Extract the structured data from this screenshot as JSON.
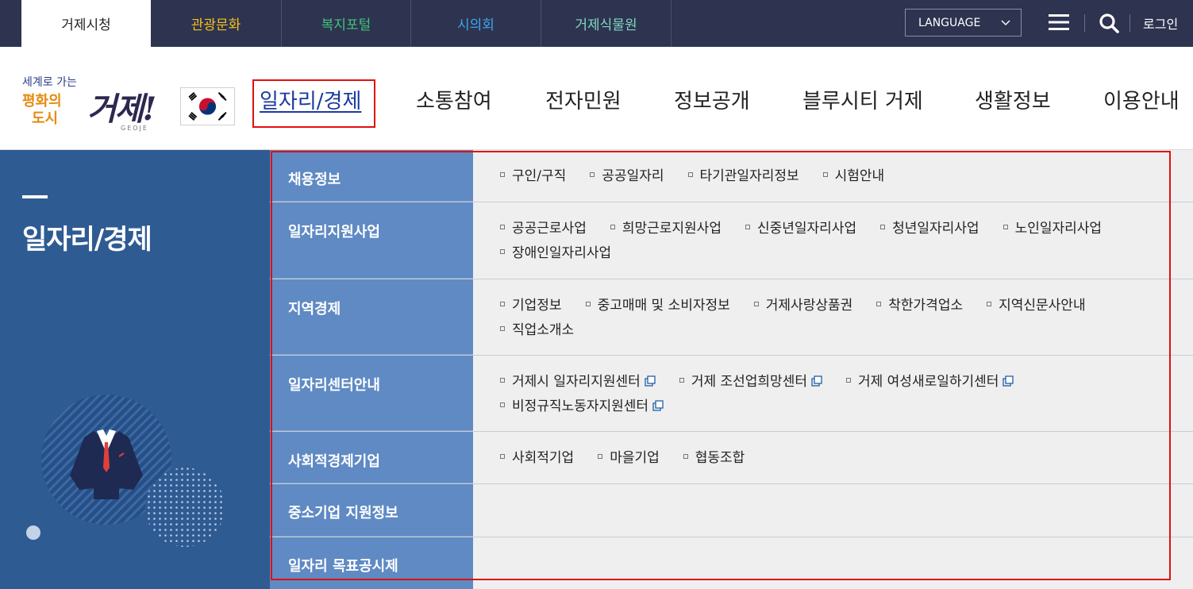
{
  "topbar": {
    "sites": [
      {
        "label": "거제시청",
        "color": "#222222"
      },
      {
        "label": "관광문화",
        "color": "#f5c21b"
      },
      {
        "label": "복지포털",
        "color": "#3fc57a"
      },
      {
        "label": "시의회",
        "color": "#3ba7ea"
      },
      {
        "label": "거제식물원",
        "color": "#7fd8c2"
      }
    ],
    "language_label": "LANGUAGE",
    "login_label": "로그인"
  },
  "header": {
    "logo": {
      "line1": "세계로 가는",
      "line2": "평화의",
      "line3": "도시",
      "brand": "거제!",
      "sub": "GEOJE"
    },
    "nav": [
      "일자리/경제",
      "소통참여",
      "전자민원",
      "정보공개",
      "블루시티 거제",
      "생활정보",
      "이용안내"
    ]
  },
  "left": {
    "title": "일자리/경제"
  },
  "mega": {
    "rows": [
      {
        "category": "채용정보",
        "links": [
          {
            "label": "구인/구직",
            "external": false
          },
          {
            "label": "공공일자리",
            "external": false
          },
          {
            "label": "타기관일자리정보",
            "external": false
          },
          {
            "label": "시험안내",
            "external": false
          }
        ]
      },
      {
        "category": "일자리지원사업",
        "links": [
          {
            "label": "공공근로사업",
            "external": false
          },
          {
            "label": "희망근로지원사업",
            "external": false
          },
          {
            "label": "신중년일자리사업",
            "external": false
          },
          {
            "label": "청년일자리사업",
            "external": false
          },
          {
            "label": "노인일자리사업",
            "external": false
          },
          {
            "label": "장애인일자리사업",
            "external": false
          }
        ]
      },
      {
        "category": "지역경제",
        "links": [
          {
            "label": "기업정보",
            "external": false
          },
          {
            "label": "중고매매 및 소비자정보",
            "external": false
          },
          {
            "label": "거제사랑상품권",
            "external": false
          },
          {
            "label": "착한가격업소",
            "external": false
          },
          {
            "label": "지역신문사안내",
            "external": false
          },
          {
            "label": "직업소개소",
            "external": false
          }
        ]
      },
      {
        "category": "일자리센터안내",
        "links": [
          {
            "label": "거제시 일자리지원센터",
            "external": true
          },
          {
            "label": "거제 조선업희망센터",
            "external": true
          },
          {
            "label": "거제 여성새로일하기센터",
            "external": true
          },
          {
            "label": "비정규직노동자지원센터",
            "external": true
          }
        ]
      },
      {
        "category": "사회적경제기업",
        "links": [
          {
            "label": "사회적기업",
            "external": false
          },
          {
            "label": "마을기업",
            "external": false
          },
          {
            "label": "협동조합",
            "external": false
          }
        ]
      },
      {
        "category": "중소기업 지원정보",
        "links": []
      },
      {
        "category": "일자리 목표공시제",
        "links": []
      }
    ]
  },
  "colors": {
    "topbar_bg": "#2e3350",
    "left_panel_bg": "#2f5b93",
    "category_bg": "#5f8ac4",
    "highlight_border": "#e01010"
  }
}
